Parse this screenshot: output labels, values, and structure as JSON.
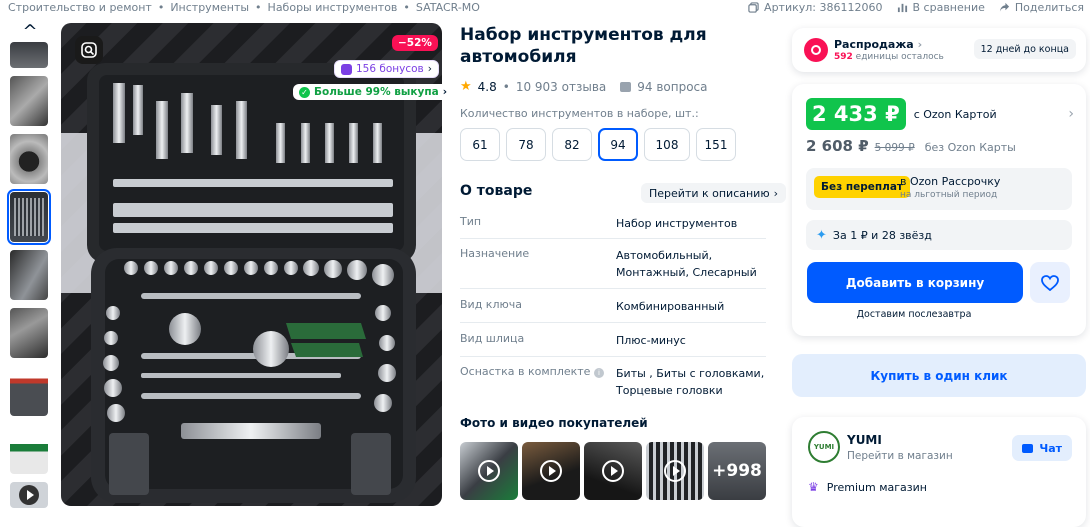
{
  "breadcrumbs": [
    "Строительство и ремонт",
    "Инструменты",
    "Наборы инструментов",
    "SATACR-MO"
  ],
  "top": {
    "article": "Артикул: 386112060",
    "compare": "В сравнение",
    "share": "Поделиться"
  },
  "image_badges": {
    "discount": "−52%",
    "bonus": "156 бонусов",
    "buyout": "Больше 99% выкупа"
  },
  "product": {
    "title": "Набор инструментов для автомобиля",
    "rating": "4.8",
    "reviews": "10 903 отзыва",
    "questions": "94 вопроса",
    "qty_label": "Количество инструментов в наборе, шт.:",
    "options": [
      "61",
      "78",
      "82",
      "94",
      "108",
      "151"
    ],
    "selected_option": "94",
    "about_title": "О товаре",
    "about_link": "Перейти к описанию",
    "specs": [
      {
        "k": "Тип",
        "v": "Набор инструментов"
      },
      {
        "k": "Назначение",
        "v": "Автомобильный, Монтажный, Слесарный"
      },
      {
        "k": "Вид ключа",
        "v": "Комбинированный"
      },
      {
        "k": "Вид шлица",
        "v": "Плюс-минус"
      },
      {
        "k": "Оснастка в комплекте",
        "v": "Биты , Биты с головками, Торцевые головки"
      }
    ],
    "photos_title": "Фото и видео покупателей",
    "photos_more": "+998"
  },
  "sale": {
    "title": "Распродажа",
    "sub_count": "592",
    "sub_text": "единицы осталось",
    "days": "12 дней до конца"
  },
  "price": {
    "ozon": "2 433 ₽",
    "ozon_label": "с Ozon Картой",
    "regular": "2 608 ₽",
    "old": "5 099 ₽",
    "regular_label": "без Ozon Карты",
    "installment_badge": "Без переплат",
    "installment_title": "в Ozon Рассрочку",
    "installment_sub": "на льготный период",
    "stars": "За 1 ₽ и 28 звёзд",
    "cart": "Добавить в корзину",
    "delivery": "Доставим послезавтра",
    "one_click": "Купить в один клик"
  },
  "seller": {
    "name": "YUMI",
    "go": "Перейти в магазин",
    "chat": "Чат",
    "premium": "Premium магазин",
    "logo_text": "YUMI"
  },
  "colors": {
    "accent": "#005bff",
    "green": "#10c44c",
    "pink": "#f91155",
    "yellow": "#ffd200"
  }
}
